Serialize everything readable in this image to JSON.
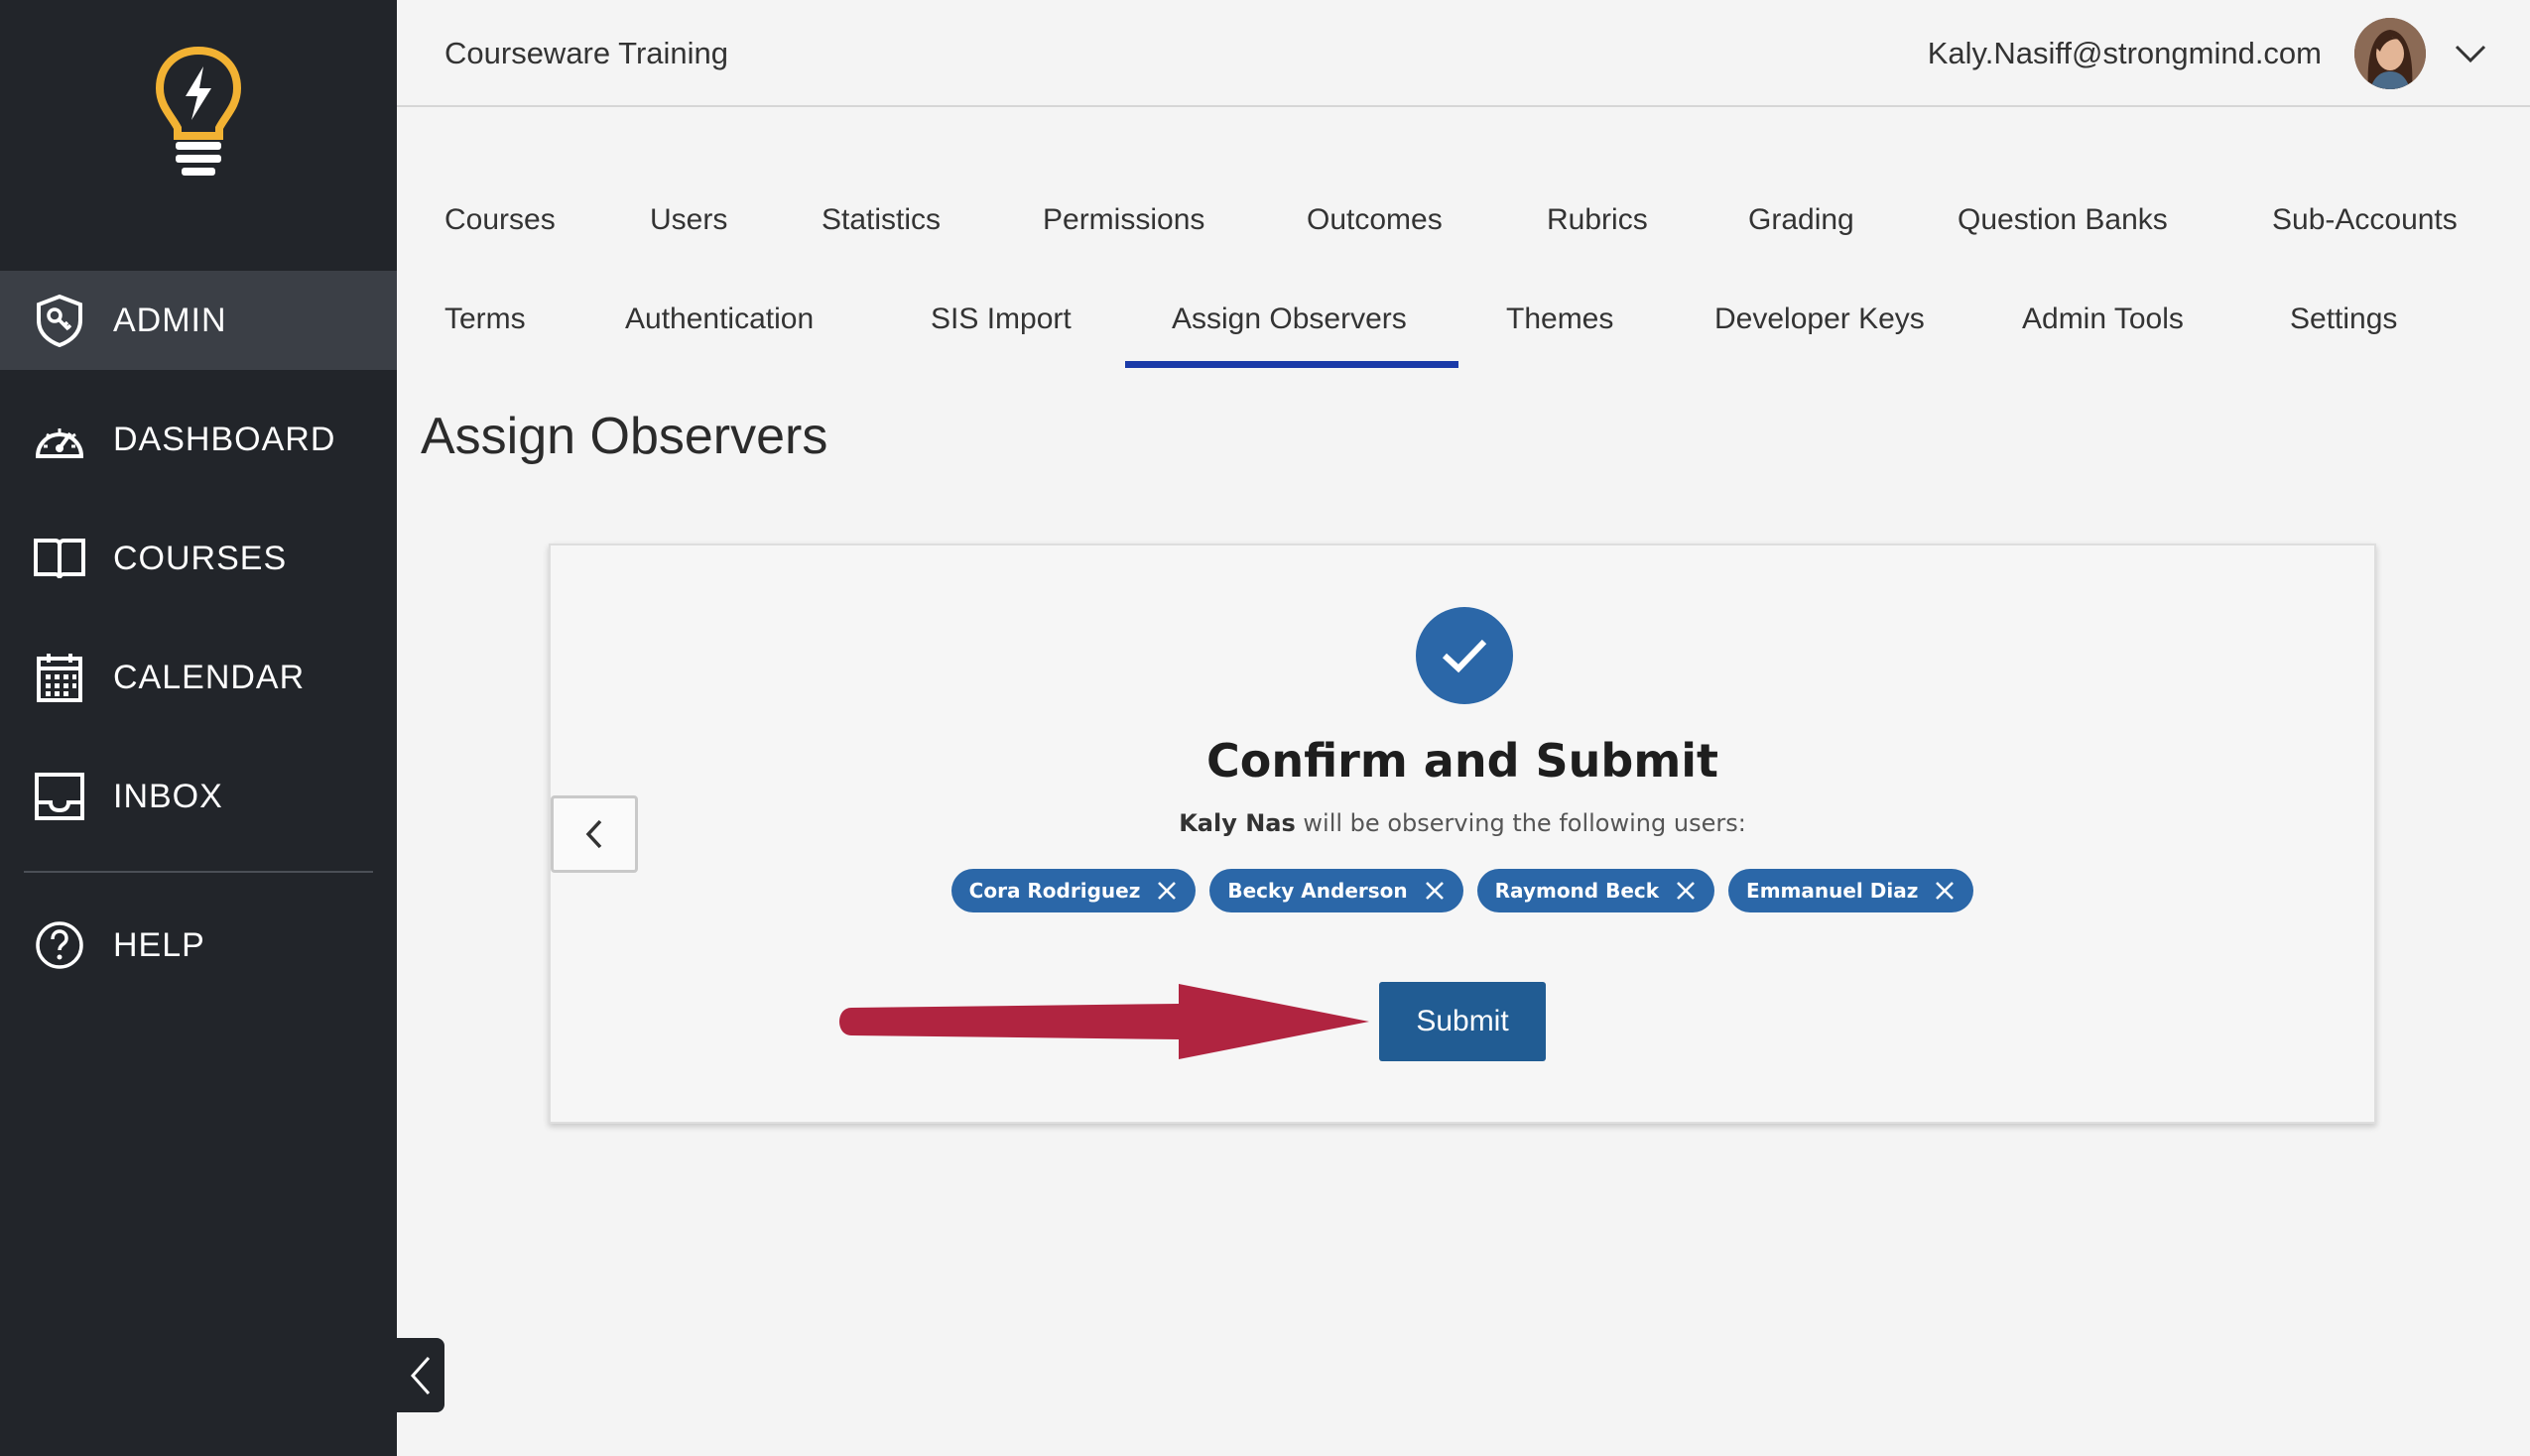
{
  "header": {
    "title": "Courseware Training",
    "email": "Kaly.Nasiff@strongmind.com"
  },
  "sidebar": {
    "items": [
      {
        "label": "ADMIN",
        "icon": "shield-key-icon"
      },
      {
        "label": "DASHBOARD",
        "icon": "speedometer-icon"
      },
      {
        "label": "COURSES",
        "icon": "book-icon"
      },
      {
        "label": "CALENDAR",
        "icon": "calendar-icon"
      },
      {
        "label": "INBOX",
        "icon": "inbox-icon"
      },
      {
        "label": "HELP",
        "icon": "help-icon"
      }
    ]
  },
  "tabs": {
    "row1": [
      "Courses",
      "Users",
      "Statistics",
      "Permissions",
      "Outcomes",
      "Rubrics",
      "Grading",
      "Question Banks",
      "Sub-Accounts"
    ],
    "row2": [
      "Terms",
      "Authentication",
      "SIS Import",
      "Assign Observers",
      "Themes",
      "Developer Keys",
      "Admin Tools",
      "Settings"
    ],
    "active": "Assign Observers"
  },
  "page": {
    "title": "Assign Observers"
  },
  "confirm": {
    "title": "Confirm and Submit",
    "observer_name": "Kaly Nas",
    "observing_text": "will be observing the following users:",
    "users": [
      "Cora Rodriguez",
      "Becky Anderson",
      "Raymond Beck",
      "Emmanuel Diaz"
    ],
    "submit_label": "Submit"
  },
  "colors": {
    "sidebar_bg": "#22252a",
    "accent_blue": "#2b67a8",
    "tab_underline": "#1a3aa8",
    "logo_yellow": "#f2b233",
    "arrow_red": "#b02440"
  }
}
